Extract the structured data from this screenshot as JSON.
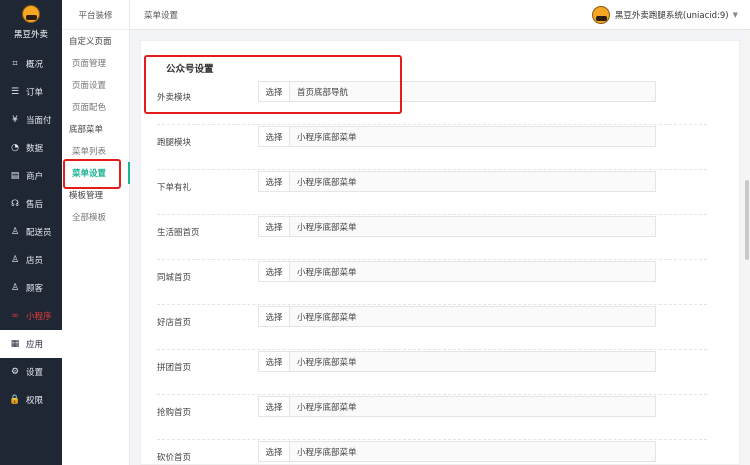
{
  "brand": {
    "name": "黑豆外卖"
  },
  "sidebar": {
    "items": [
      {
        "label": "概况",
        "icon": "overview-icon",
        "glyph": "⌗"
      },
      {
        "label": "订单",
        "icon": "order-icon",
        "glyph": "☰"
      },
      {
        "label": "当面付",
        "icon": "pay-icon",
        "glyph": "¥"
      },
      {
        "label": "数据",
        "icon": "data-icon",
        "glyph": "◔"
      },
      {
        "label": "商户",
        "icon": "store-icon",
        "glyph": "▤"
      },
      {
        "label": "售后",
        "icon": "aftersale-icon",
        "glyph": "☊"
      },
      {
        "label": "配送员",
        "icon": "courier-icon",
        "glyph": "♙"
      },
      {
        "label": "店员",
        "icon": "clerk-icon",
        "glyph": "♙"
      },
      {
        "label": "顾客",
        "icon": "customer-icon",
        "glyph": "♙"
      },
      {
        "label": "小程序",
        "icon": "miniprogram-icon",
        "glyph": "∞"
      },
      {
        "label": "应用",
        "icon": "apps-icon",
        "glyph": "▦"
      },
      {
        "label": "设置",
        "icon": "settings-icon",
        "glyph": "⚙"
      },
      {
        "label": "权限",
        "icon": "lock-icon",
        "glyph": "🔒"
      }
    ]
  },
  "subnav": {
    "header": "平台装修",
    "sections": [
      {
        "label": "自定义页面",
        "children": [
          "页面管理",
          "页面设置",
          "页面配色"
        ]
      },
      {
        "label": "底部菜单",
        "children": [
          "菜单列表",
          "菜单设置"
        ]
      },
      {
        "label": "模板管理",
        "children": [
          "全部模板"
        ]
      }
    ],
    "active": "菜单设置"
  },
  "topbar": {
    "breadcrumb": "菜单设置",
    "account": "黑豆外卖跑腿系统(uniacid:9)"
  },
  "content": {
    "section_title": "公众号设置",
    "select_button": "选择",
    "rows": [
      {
        "label": "外卖模块",
        "value": "首页底部导航"
      },
      {
        "label": "跑腿模块",
        "value": "小程序底部菜单"
      },
      {
        "label": "下单有礼",
        "value": "小程序底部菜单"
      },
      {
        "label": "生活圈首页",
        "value": "小程序底部菜单"
      },
      {
        "label": "同城首页",
        "value": "小程序底部菜单"
      },
      {
        "label": "好店首页",
        "value": "小程序底部菜单"
      },
      {
        "label": "拼团首页",
        "value": "小程序底部菜单"
      },
      {
        "label": "抢购首页",
        "value": "小程序底部菜单"
      },
      {
        "label": "砍价首页",
        "value": "小程序底部菜单"
      }
    ]
  },
  "colors": {
    "sidebar_bg": "#1f2735",
    "accent": "#1ab394",
    "active_red": "#e23b3b",
    "annotation": "#e41c1c"
  }
}
